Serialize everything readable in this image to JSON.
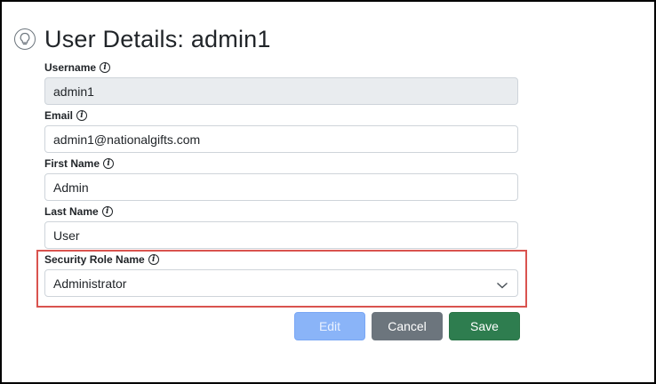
{
  "page": {
    "title": "User Details: admin1",
    "icon": "lightbulb-icon"
  },
  "form": {
    "username": {
      "label": "Username",
      "value": "admin1"
    },
    "email": {
      "label": "Email",
      "value": "admin1@nationalgifts.com"
    },
    "first_name": {
      "label": "First Name",
      "value": "Admin"
    },
    "last_name": {
      "label": "Last Name",
      "value": "User"
    },
    "security_role": {
      "label": "Security Role Name",
      "value": "Administrator"
    }
  },
  "buttons": {
    "edit": "Edit",
    "cancel": "Cancel",
    "save": "Save"
  },
  "colors": {
    "highlight": "#d9534f",
    "edit": "#8ab4f8",
    "cancel": "#6c757d",
    "save": "#2e7d4f"
  }
}
